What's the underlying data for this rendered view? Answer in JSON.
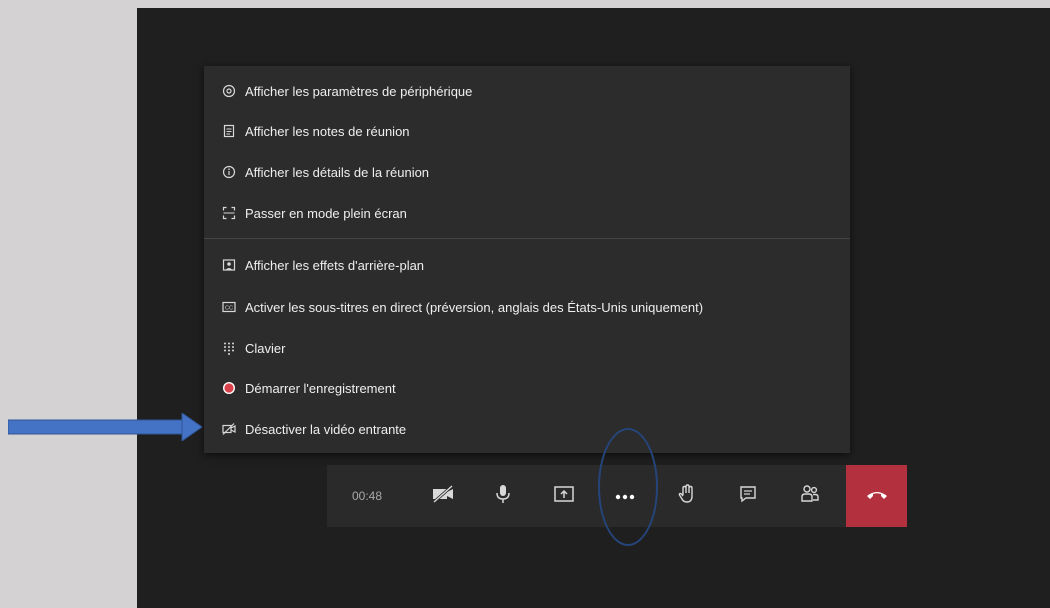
{
  "menu": {
    "items": [
      {
        "label": "Afficher les paramètres de périphérique",
        "icon": "gear-icon"
      },
      {
        "label": "Afficher les notes de réunion",
        "icon": "notes-icon"
      },
      {
        "label": "Afficher les détails de la réunion",
        "icon": "info-icon"
      },
      {
        "label": "Passer en mode plein écran",
        "icon": "fullscreen-icon"
      },
      {
        "label": "Afficher les effets d'arrière-plan",
        "icon": "background-effects-icon"
      },
      {
        "label": "Activer les sous-titres en direct (préversion, anglais des États-Unis uniquement)",
        "icon": "captions-icon"
      },
      {
        "label": "Clavier",
        "icon": "dialpad-icon"
      },
      {
        "label": "Démarrer l'enregistrement",
        "icon": "record-icon"
      },
      {
        "label": "Désactiver la vidéo entrante",
        "icon": "video-off-icon"
      }
    ]
  },
  "toolbar": {
    "timer": "00:48",
    "buttons": [
      "camera-off-icon",
      "microphone-icon",
      "share-screen-icon",
      "more-options-icon",
      "raise-hand-icon",
      "chat-icon",
      "participants-icon",
      "hang-up-icon"
    ]
  },
  "colors": {
    "hangup": "#b3313f",
    "record": "#d9414b",
    "annotation": "#4472c4"
  }
}
